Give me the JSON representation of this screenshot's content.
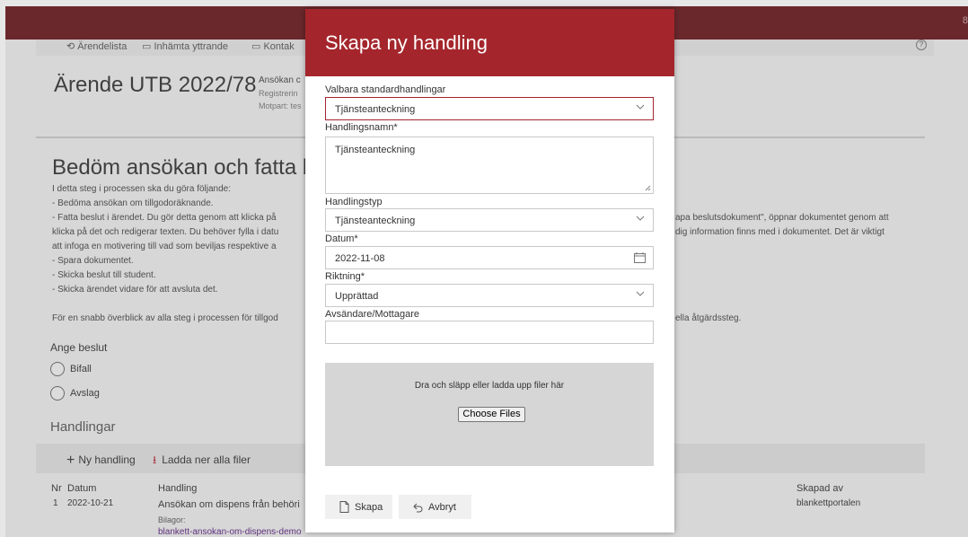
{
  "background": {
    "corner_text": "8",
    "nav": {
      "arendelista": "Ärendelista",
      "yttrande": "Inhämta yttrande",
      "kontakt": "Kontak"
    },
    "case": {
      "title": "Ärende UTB 2022/78",
      "type": "Ansökan c",
      "registrering": "Registrerin",
      "motpart": "Motpart: tes"
    },
    "step": {
      "title": "Bedöm ansökan och fatta bes",
      "lines": [
        "I detta steg i processen ska du göra följande:",
        "- Bedöma ansökan om tillgodoräknande.",
        "- Fatta beslut i ärendet. Du gör detta genom att klicka på",
        "klicka på det och redigerar texten. Du behöver fylla i datu",
        "att infoga en motivering till vad som beviljas respektive a",
        "- Spara dokumentet.",
        "- Skicka beslut till student.",
        "- Skicka ärendet vidare för att avsluta det.",
        "",
        "För en snabb överblick av alla steg i processen för tillgod"
      ],
      "right_lines": [
        "apa beslutsdokument\", öppnar dokumentet genom att",
        "dig information finns med i dokumentet. Det är viktigt",
        "ella åtgärdssteg."
      ]
    },
    "decision": {
      "label": "Ange beslut",
      "options": [
        "Bifall",
        "Avslag"
      ]
    },
    "documents": {
      "title": "Handlingar",
      "new_label": "Ny handling",
      "download_label": "Ladda ner alla filer",
      "headers": {
        "nr": "Nr",
        "datum": "Datum",
        "handling": "Handling",
        "skapad_av": "Skapad av"
      },
      "rows": [
        {
          "nr": "1",
          "datum": "2022-10-21",
          "handling": "Ansökan om dispens från behöri",
          "bilagor_label": "Bilagor:",
          "bilaga_link": "blankett-ansokan-om-dispens-demo",
          "skapad_av": "blankettportalen"
        }
      ]
    }
  },
  "modal": {
    "title": "Skapa ny handling",
    "fields": {
      "standard_label": "Valbara standardhandlingar",
      "standard_value": "Tjänsteanteckning",
      "name_label": "Handlingsnamn*",
      "name_value": "Tjänsteanteckning",
      "type_label": "Handlingstyp",
      "type_value": "Tjänsteanteckning",
      "date_label": "Datum*",
      "date_value": "2022-11-08",
      "direction_label": "Riktning*",
      "direction_value": "Upprättad",
      "sender_label": "Avsändare/Mottagare",
      "sender_value": ""
    },
    "dropzone": {
      "message": "Dra och släpp eller ladda upp filer här",
      "choose_files": "Choose Files"
    },
    "buttons": {
      "create": "Skapa",
      "cancel": "Avbryt"
    }
  },
  "colors": {
    "header_red": "#a4262c",
    "topbar_dark": "#67161b"
  }
}
